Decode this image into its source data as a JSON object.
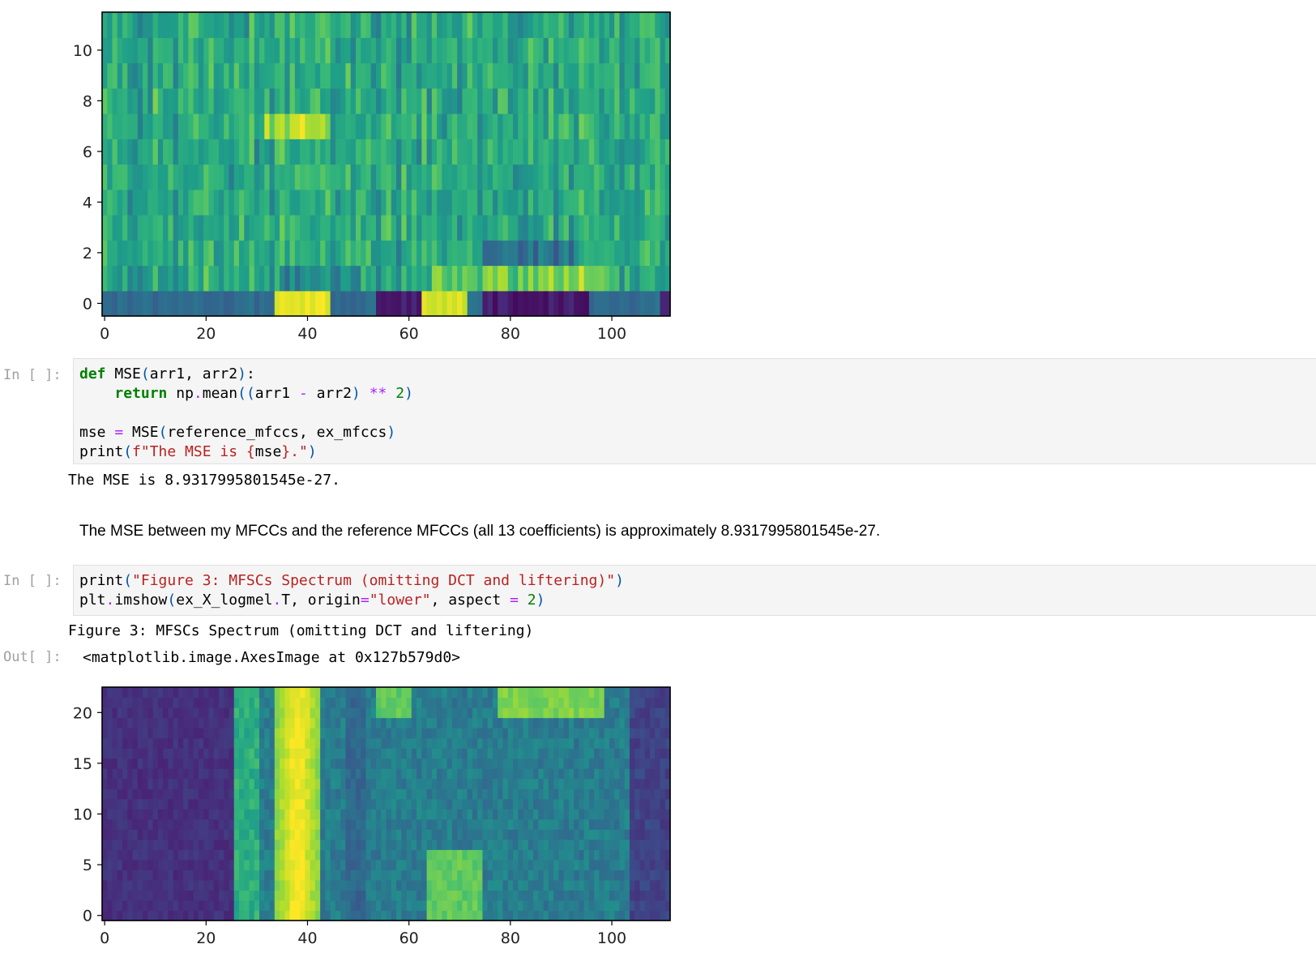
{
  "notebook": {
    "cell1": {
      "prompt": "In [ ]:",
      "code": {
        "l1": [
          "def",
          " MSE",
          "(",
          "arr1, arr2",
          ")",
          ":"
        ],
        "l2": [
          "    ",
          "return",
          " np",
          ".",
          "mean",
          "((",
          "arr1 ",
          "-",
          " arr2",
          ")",
          " ",
          "**",
          " ",
          "2",
          ")"
        ],
        "l4": [
          "mse ",
          "=",
          " MSE",
          "(",
          "reference_mfccs, ex_mfccs",
          ")"
        ],
        "l5": [
          "print",
          "(",
          "f\"The MSE is ",
          "{",
          "mse",
          "}",
          ".\"",
          ")"
        ]
      },
      "output": "The MSE is 8.9317995801545e-27."
    },
    "markdown": "The MSE between my MFCCs and the reference MFCCs (all 13 coefficients) is approximately 8.9317995801545e-27.",
    "cell2": {
      "prompt": "In [ ]:",
      "code": {
        "l1": [
          "print",
          "(",
          "\"Figure 3: MFSCs Spectrum (omitting DCT and liftering)\"",
          ")"
        ],
        "l2": [
          "plt",
          ".",
          "imshow",
          "(",
          "ex_X_logmel",
          ".",
          "T, origin",
          "=",
          "\"lower\"",
          ", aspect ",
          "=",
          " ",
          "2",
          ")"
        ]
      },
      "stdout": "Figure 3: MFSCs Spectrum (omitting DCT and liftering)",
      "out_prompt": "Out[ ]:",
      "out_value": "<matplotlib.image.AxesImage at 0x127b579d0>"
    }
  },
  "chart_data": [
    {
      "type": "heatmap",
      "colormap": "viridis",
      "title": "",
      "xlabel": "",
      "ylabel": "",
      "n_cols": 112,
      "n_rows": 12,
      "xlim": [
        -0.5,
        111.5
      ],
      "ylim": [
        -0.5,
        11.5
      ],
      "xticks": [
        0,
        20,
        40,
        60,
        80,
        100
      ],
      "yticks": [
        0,
        2,
        4,
        6,
        8,
        10
      ],
      "xtick_labels": [
        "0",
        "20",
        "40",
        "60",
        "80",
        "100"
      ],
      "ytick_labels": [
        "0",
        "2",
        "4",
        "6",
        "8",
        "10"
      ]
    },
    {
      "type": "heatmap",
      "colormap": "viridis",
      "title": "",
      "xlabel": "",
      "ylabel": "",
      "n_cols": 112,
      "n_rows": 23,
      "xlim": [
        -0.5,
        111.5
      ],
      "ylim": [
        -0.5,
        22.5
      ],
      "xticks": [
        0,
        20,
        40,
        60,
        80,
        100
      ],
      "yticks": [
        0,
        5,
        10,
        15,
        20
      ],
      "xtick_labels": [
        "0",
        "20",
        "40",
        "60",
        "80",
        "100"
      ],
      "ytick_labels": [
        "0",
        "5",
        "10",
        "15",
        "20"
      ]
    }
  ]
}
